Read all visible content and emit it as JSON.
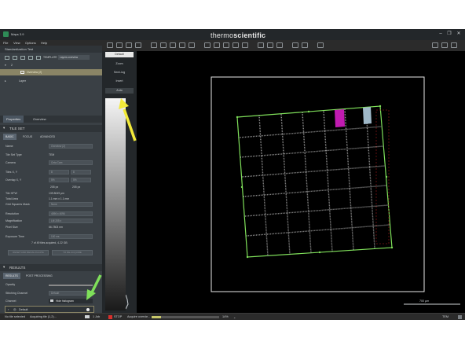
{
  "app": {
    "title": "Maps 3.9",
    "brand_thin": "thermo",
    "brand_bold": "scientific"
  },
  "menu": [
    "File",
    "View",
    "Options",
    "Help"
  ],
  "project": {
    "name": "Standardization Test",
    "layer_count": "2",
    "template_label": "TEMPLATE",
    "template_value": "Layers overview",
    "tile_item": "Overview (2)",
    "layer_label": "Layer"
  },
  "tabs": {
    "properties": "Properties",
    "overview": "Overview"
  },
  "tile_set": {
    "header": "TILE SET",
    "subtabs": [
      "BASIC",
      "FOCUS",
      "ADVANCED"
    ],
    "fields": {
      "name_label": "Name",
      "name_value": "Overview (2)",
      "type_label": "Tile Set Type",
      "type_value": "TEM",
      "camera_label": "Camera",
      "camera_value": "Ceta Cam",
      "tiles_label": "Tiles X, Y",
      "tiles_x": "8",
      "tiles_y": "8",
      "overlap_label": "Overlap X, Y",
      "overlap_x": "5%",
      "overlap_y": "5%",
      "pixels_x": "205 px",
      "pixels_y": "205 px",
      "hfw_label": "Tile HFW",
      "hfw_value": "139.8049 µm",
      "area_label": "Total Area",
      "area_value": "1.1 mm x 1.1 mm",
      "grid_label": "Grid Squares Mask",
      "grid_value": "None",
      "resolution_label": "Resolution",
      "resolution_value": "4096 x 4096",
      "mag_label": "Magnification",
      "mag_value": "LM 205 x",
      "pixel_label": "Pixel Size",
      "pixel_value": "66.7803 nm",
      "exposure_label": "Exposure Time",
      "exposure_value": "100 ms",
      "acquired_text": "7 of 49 tiles acquired, 4.22 GB",
      "btn_recalc": "RESET AND RECALCULATE",
      "btn_reacquire": "TO RE-ACQUIRE"
    }
  },
  "results": {
    "header": "RESULTS",
    "subtabs": [
      "RESULTS",
      "POST PROCESSING"
    ],
    "opacity_label": "Opacity",
    "stitching_label": "Stitching Channel",
    "stitching_value": "Default",
    "channel_label": "Channel",
    "hide_histogram": "Hide histogram",
    "default_channel": "Default"
  },
  "histogram": {
    "buttons": [
      "Default",
      "Zoom",
      "Semi-log",
      "Invert",
      "Auto"
    ]
  },
  "viewer": {
    "scale": "700 µm"
  },
  "status": {
    "selection": "No tile selected",
    "acquiring": "Acquiring tile (1,2)...",
    "job": "1 Job",
    "stop": "STOP",
    "acquire_text": "Acquire overvie...",
    "progress": 0.14,
    "progress_label": "14%",
    "mode": "TEM"
  },
  "colors": {
    "accent_green": "#7fe05a",
    "magenta": "#c01bb0",
    "highlight": "#8a8566"
  }
}
